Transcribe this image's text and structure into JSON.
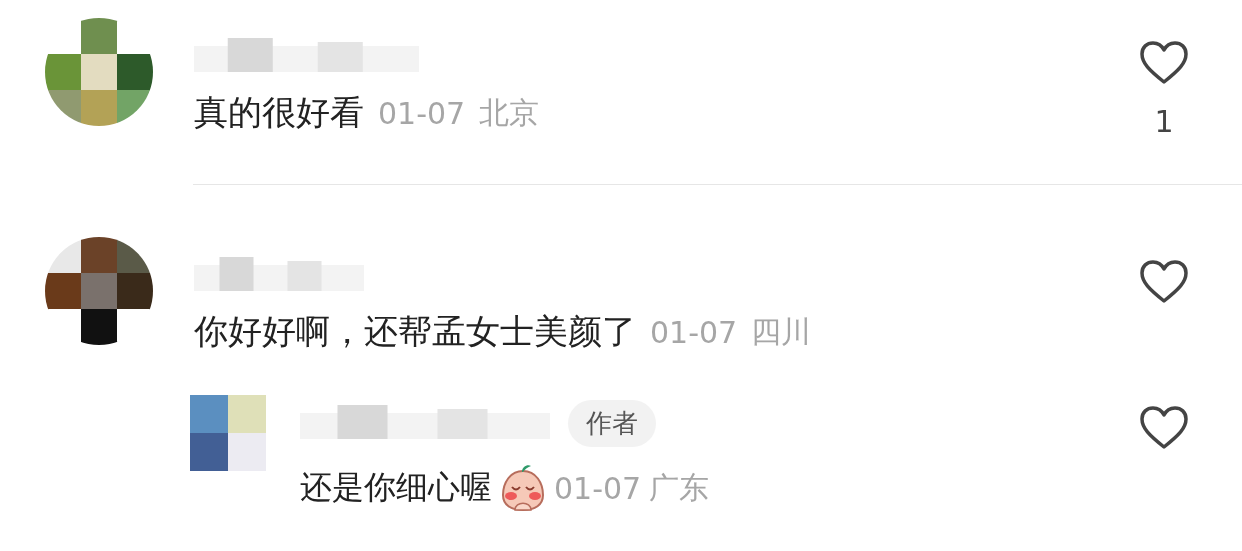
{
  "comments": [
    {
      "text": "真的很好看",
      "date": "01-07",
      "location": "北京",
      "like_count": "1"
    },
    {
      "text": "你好好啊，还帮孟女士美颜了",
      "date": "01-07",
      "location": "四川",
      "children": [
        {
          "badge": "作者",
          "text": "还是你细心喔",
          "sticker": true,
          "date": "01-07",
          "location": "广东"
        }
      ]
    }
  ]
}
